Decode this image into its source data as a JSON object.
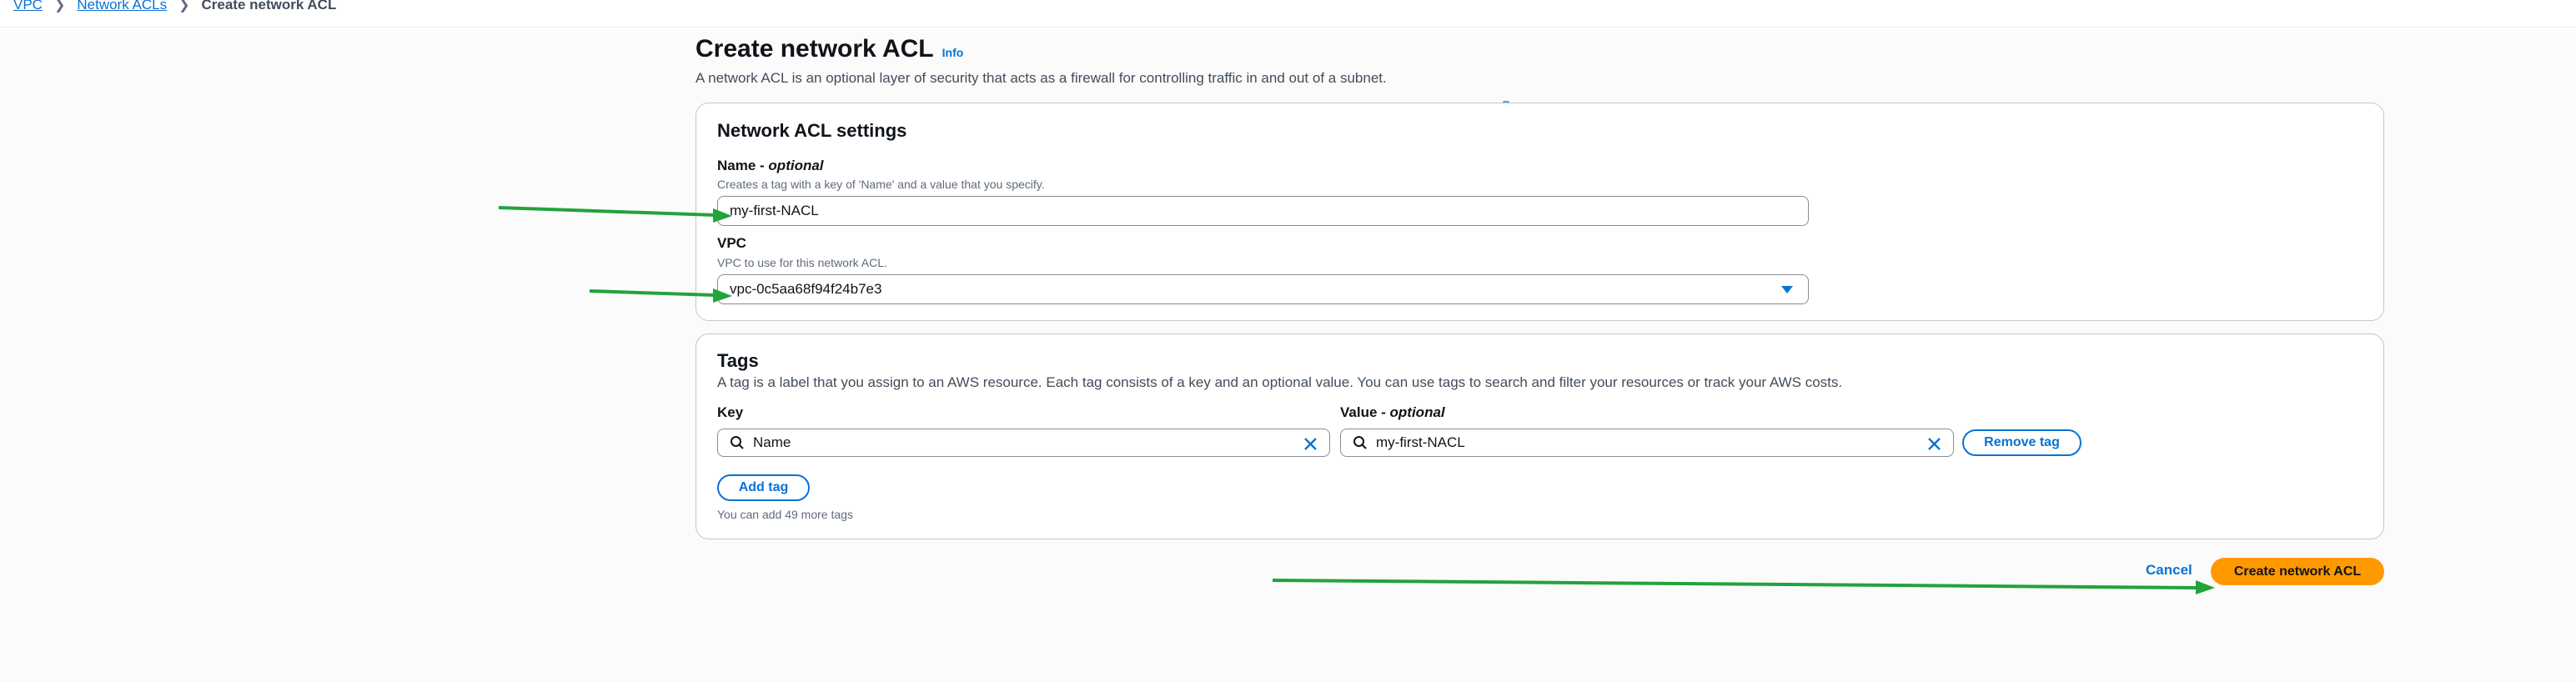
{
  "breadcrumb": {
    "items": [
      "VPC",
      "Network ACLs"
    ],
    "current": "Create network ACL"
  },
  "page": {
    "title": "Create network ACL",
    "info_link": "Info",
    "description": "A network ACL is an optional layer of security that acts as a firewall for controlling traffic in and out of a subnet."
  },
  "settings": {
    "heading": "Network ACL settings",
    "name_label": "Name - ",
    "name_optional": "optional",
    "name_hint": "Creates a tag with a key of 'Name' and a value that you specify.",
    "name_value": "my-first-NACL",
    "vpc_label": "VPC",
    "vpc_hint": "VPC to use for this network ACL.",
    "vpc_value": "vpc-0c5aa68f94f24b7e3"
  },
  "tags": {
    "heading": "Tags",
    "description": "A tag is a label that you assign to an AWS resource. Each tag consists of a key and an optional value. You can use tags to search and filter your resources or track your AWS costs.",
    "key_label": "Key",
    "value_label": "Value - ",
    "value_optional": "optional",
    "rows": [
      {
        "key": "Name",
        "value": "my-first-NACL"
      }
    ],
    "remove_label": "Remove tag",
    "add_label": "Add tag",
    "remaining": "You can add 49 more tags"
  },
  "actions": {
    "cancel": "Cancel",
    "create": "Create network ACL"
  },
  "colors": {
    "link": "#0972d3",
    "primary": "#ff9900",
    "annotation_arrow": "#22a33c"
  },
  "icons": [
    "chevron-right-icon",
    "chevron-down-icon",
    "search-icon",
    "close-icon"
  ]
}
